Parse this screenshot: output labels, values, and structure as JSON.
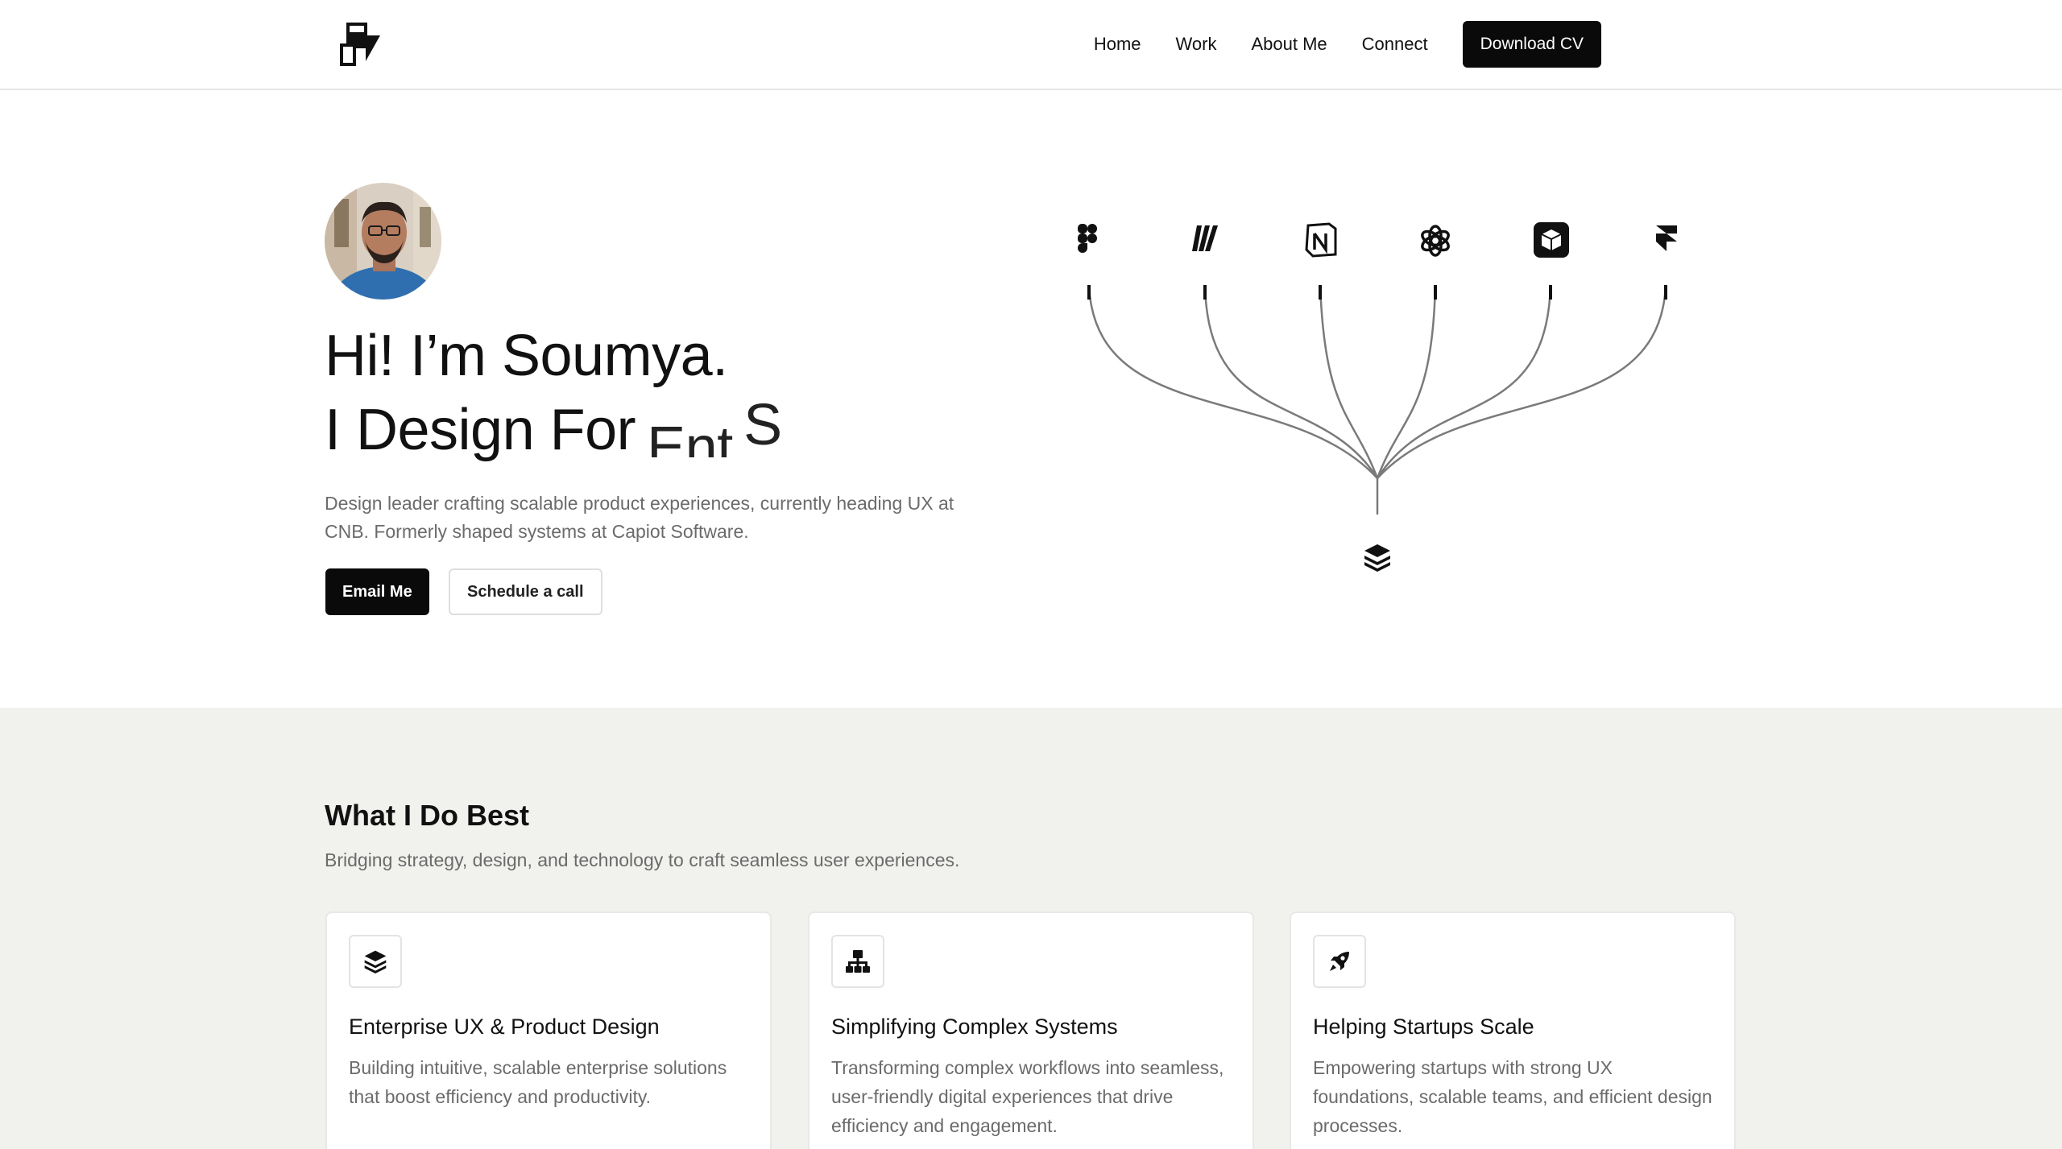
{
  "nav": {
    "links": [
      "Home",
      "Work",
      "About Me",
      "Connect"
    ],
    "cta": "Download CV"
  },
  "hero": {
    "title_line1": "Hi! I’m Soumya.",
    "title_line2_prefix": "I Design For",
    "rotating_word_partial": "Ent",
    "rotating_word_next_partial": "S",
    "description": "Design leader crafting scalable product experiences, currently heading UX at CNB. Formerly shaped systems at Capiot Software.",
    "primary_button": "Email Me",
    "secondary_button": "Schedule a call",
    "tools": [
      "figma-icon",
      "miro-icon",
      "notion-icon",
      "openai-icon",
      "cube-app-icon",
      "framer-icon"
    ],
    "hub_icon": "layers-icon"
  },
  "services": {
    "title": "What I Do Best",
    "subtitle": "Bridging strategy, design, and technology to craft seamless user experiences.",
    "cards": [
      {
        "icon": "layers-icon",
        "title": "Enterprise UX & Product Design",
        "description": "Building intuitive, scalable enterprise solutions that boost efficiency and productivity."
      },
      {
        "icon": "hierarchy-icon",
        "title": "Simplifying Complex Systems",
        "description": "Transforming complex workflows into seamless, user-friendly digital experiences that drive efficiency and engagement."
      },
      {
        "icon": "rocket-icon",
        "title": "Helping Startups Scale",
        "description": "Empowering startups with strong UX foundations, scalable teams, and efficient design processes."
      }
    ]
  },
  "colors": {
    "primary": "#0a0a0a",
    "muted_text": "#6b6b6b",
    "section_bg": "#f1f1ee",
    "line": "#7a7a7a"
  }
}
